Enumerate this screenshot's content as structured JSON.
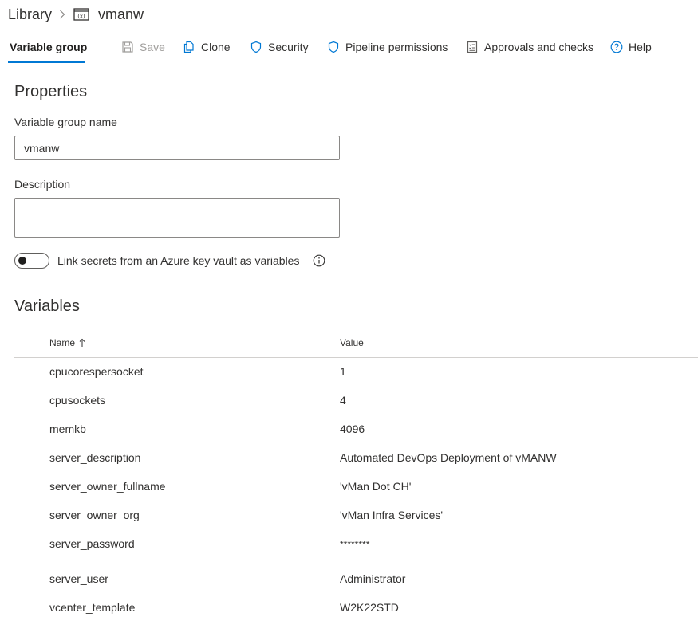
{
  "breadcrumb": {
    "root": "Library",
    "current": "vmanw"
  },
  "toolbar": {
    "active_tab": "Variable group",
    "save": "Save",
    "clone": "Clone",
    "security": "Security",
    "pipeline_permissions": "Pipeline permissions",
    "approvals": "Approvals and checks",
    "help": "Help"
  },
  "properties": {
    "heading": "Properties",
    "name_label": "Variable group name",
    "name_value": "vmanw",
    "description_label": "Description",
    "description_value": "",
    "link_secrets_label": "Link secrets from an Azure key vault as variables",
    "link_secrets_enabled": false
  },
  "variables": {
    "heading": "Variables",
    "col_name": "Name",
    "col_value": "Value",
    "rows": [
      {
        "name": "cpucorespersocket",
        "value": "1"
      },
      {
        "name": "cpusockets",
        "value": "4"
      },
      {
        "name": "memkb",
        "value": "4096"
      },
      {
        "name": "server_description",
        "value": "Automated DevOps Deployment of vMANW"
      },
      {
        "name": "server_owner_fullname",
        "value": "'vMan Dot CH'"
      },
      {
        "name": "server_owner_org",
        "value": "'vMan Infra Services'"
      },
      {
        "name": "server_password",
        "value": "********"
      },
      {
        "name": "server_user",
        "value": "Administrator"
      },
      {
        "name": "vcenter_template",
        "value": "W2K22STD"
      }
    ]
  },
  "colors": {
    "accent": "#0078d4",
    "text": "#323130",
    "disabled": "#a19f9d"
  }
}
